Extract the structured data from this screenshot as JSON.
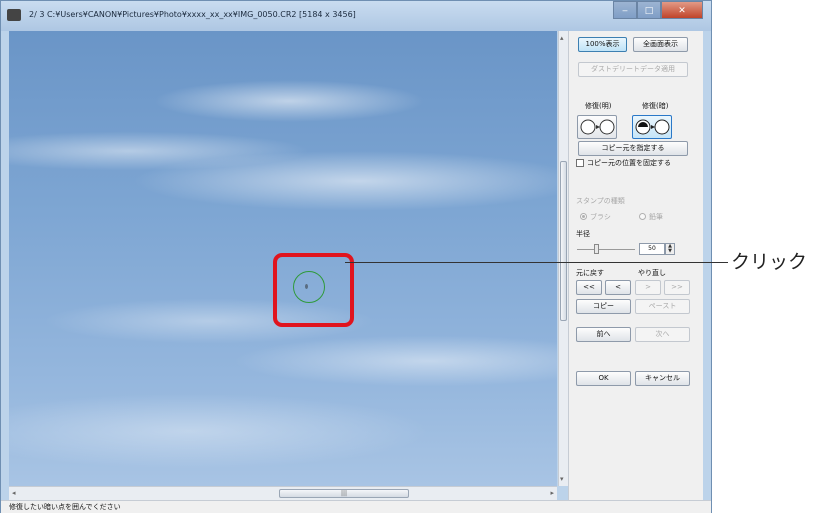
{
  "window": {
    "title": "2/ 3  C:¥Users¥CANON¥Pictures¥Photo¥xxxx_xx_xx¥IMG_0050.CR2 [5184 x 3456]",
    "minimize": "‒",
    "maximize": "□",
    "close": "✕"
  },
  "panel": {
    "view_100_label": "100%表示",
    "fit_view_label": "全画面表示",
    "apply_dust_data_label": "ダストデリートデータ適用",
    "mode_left_label": "修復(明)",
    "mode_right_label": "修復(暗)",
    "set_copy_source_label": "コピー元を指定する",
    "fix_copy_source_label": "コピー元の位置を固定する",
    "stamp_type_label": "スタンプの種類",
    "brush_label": "ブラシ",
    "pencil_label": "鉛筆",
    "radius_label": "半径",
    "radius_value": "50",
    "radius_fraction": 0.33,
    "undo_label": "元に戻す",
    "redo_label": "やり直し",
    "undo_all_label": "<<",
    "undo_one_label": "<",
    "redo_one_label": ">",
    "redo_all_label": ">>",
    "copy_label": "コピー",
    "paste_label": "ペースト",
    "prev_label": "前へ",
    "next_label": "次へ",
    "ok_label": "OK",
    "cancel_label": "キャンセル"
  },
  "scrollbars": {
    "h_left": "◂",
    "h_right": "▸",
    "h_grip": "|||",
    "v_up": "▴",
    "v_down": "▾"
  },
  "status_text": "修復したい暗い点を囲んでください",
  "callout_label": "クリック",
  "colors": {
    "highlight": "#e0141e",
    "stamp_cursor": "#2f9a3a"
  }
}
